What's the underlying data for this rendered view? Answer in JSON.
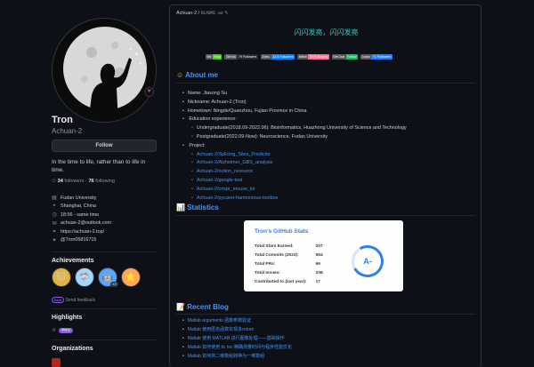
{
  "profile": {
    "name": "Tron",
    "login": "Achuan-2",
    "follow_label": "Follow",
    "bio": "In the time to life, rather than to life in time.",
    "followers": "34",
    "followers_label": "followers",
    "following": "76",
    "following_label": "following",
    "status_emoji": "♥",
    "vcard": [
      {
        "icon": "organization-icon",
        "glyph": "▤",
        "text": "Fudan University"
      },
      {
        "icon": "location-icon",
        "glyph": "⌖",
        "text": "Shanghai, China"
      },
      {
        "icon": "clock-icon",
        "glyph": "◷",
        "text": "18:56 - same time"
      },
      {
        "icon": "mail-icon",
        "glyph": "✉",
        "text": "achuan-2@outlook.com"
      },
      {
        "icon": "link-icon",
        "glyph": "⚭",
        "text": "https://achuan-2.top/"
      },
      {
        "icon": "twitter-icon",
        "glyph": "✦",
        "text": "@Tron05816715"
      }
    ]
  },
  "achievements": {
    "title": "Achievements",
    "badges": [
      {
        "icon": "quickdraw-badge-icon",
        "glyph": "🐱",
        "color": "#e3b341"
      },
      {
        "icon": "pull-shark-badge-icon",
        "glyph": "🦈",
        "color": "#a5d6ff"
      },
      {
        "icon": "yolo-badge-icon",
        "glyph": "🤖",
        "color": "#58a6ff",
        "count": "x2"
      },
      {
        "icon": "starstruck-badge-icon",
        "glyph": "⭐",
        "color": "#ffa657"
      }
    ],
    "beta_label": "Beta",
    "feedback_label": "Send feedback"
  },
  "highlights": {
    "title": "Highlights",
    "pro_label": "PRO"
  },
  "organizations": {
    "title": "Organizations"
  },
  "readme": {
    "breadcrumb_user": "Achuan-2",
    "breadcrumb_file": "README.md",
    "greeting": "闪闪发亮，闪闪发亮",
    "shields": [
      {
        "left": "BN",
        "right": "Blog",
        "color": "#4c1"
      },
      {
        "left": "GitHub",
        "right": "79 Followers",
        "color": "#24292f"
      },
      {
        "left": "Zhihu",
        "right": "33.5 Followers",
        "color": "#0084ff"
      },
      {
        "left": "Bilibili",
        "right": "33 Followers",
        "color": "#fb7299"
      },
      {
        "left": "WeChat",
        "right": "Follow",
        "color": "#07c160"
      },
      {
        "left": "Juejin",
        "right": "71 Followers",
        "color": "#1e80ff"
      }
    ],
    "about_title": "About me",
    "about_items": [
      "Name: Jiasong Su",
      "Nickname: Achuan-2 (Tron)",
      "Hometown: Ningde/Quanzhou, Fujian Province in China",
      "Education experience:"
    ],
    "education": [
      "Undergraduate(2018.09-2022.06): Bioinformatics, Huazhong University of Science and Technology",
      "Postgraduate(2022.09-Now): Neuroscience, Fudan University"
    ],
    "project_label": "Project:",
    "projects": [
      "Achuan-2/Splicing_Sites_Predictor",
      "Achuan-2/Alzheimer_GBS_analysis",
      "Achuan-2/notion_resource",
      "Achuan-2/google-test",
      "Achuan-2/crispr_mouse_kit",
      "Achuan-2/pycaret-harmonious-toolbox"
    ],
    "stats_title": "Statistics",
    "stats": {
      "card_title": "Tron's GitHub Stats",
      "rows": [
        {
          "label": "Total Stars Earned:",
          "value": "207"
        },
        {
          "label": "Total Commits (2023):",
          "value": "554"
        },
        {
          "label": "Total PRs:",
          "value": "66"
        },
        {
          "label": "Total Issues:",
          "value": "238"
        },
        {
          "label": "Contributed to (last year):",
          "value": "17"
        }
      ],
      "grade": "A-",
      "grade_fraction": 0.72
    },
    "blog_title": "Recent Blog",
    "blog": [
      "Matlab arguments 函数参数验证",
      "Matlab 使用匿名函数实现多return",
      "Matlab 使用 MATLAB 进行图像处理——基础操作",
      "Matlab 如何使用 tic toc 精确测量时间与程序性能优化",
      "Matlab 如何将二维数组转换为一维数组"
    ]
  },
  "colors": {
    "background": "#0d1117",
    "accent": "#4493f8",
    "greeting": "#39c5bb"
  }
}
